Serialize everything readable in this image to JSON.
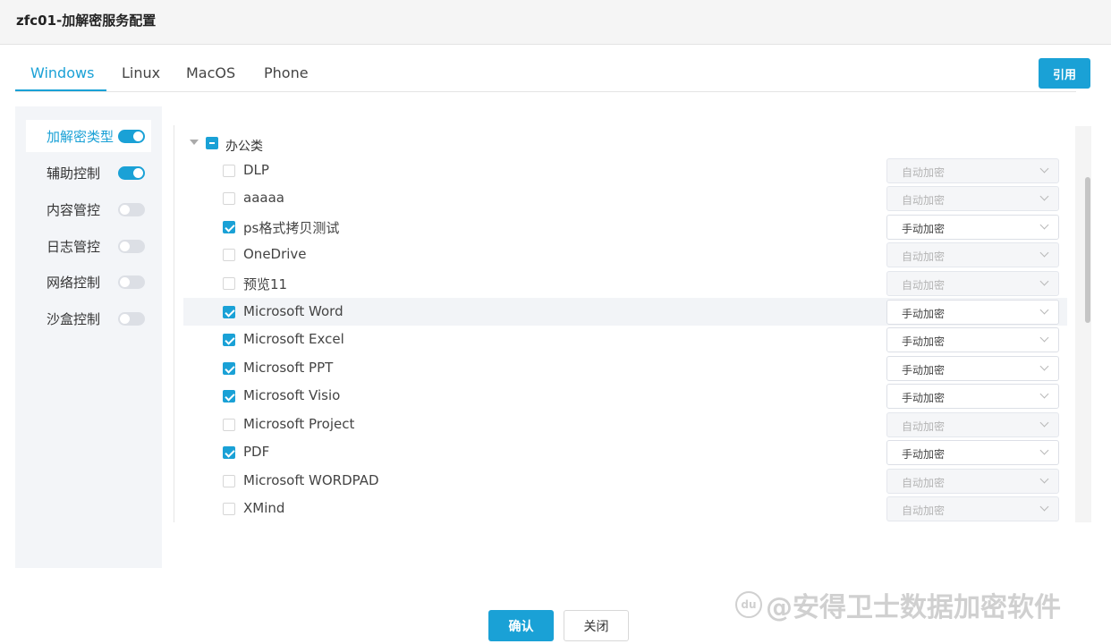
{
  "dialog": {
    "title": "zfc01-加解密服务配置"
  },
  "tabs": [
    {
      "label": "Windows",
      "active": true
    },
    {
      "label": "Linux",
      "active": false
    },
    {
      "label": "MacOS",
      "active": false
    },
    {
      "label": "Phone",
      "active": false
    }
  ],
  "cite_button": "引用",
  "sidebar": {
    "items": [
      {
        "label": "加解密类型",
        "enabled": true,
        "active": true
      },
      {
        "label": "辅助控制",
        "enabled": true,
        "active": false
      },
      {
        "label": "内容管控",
        "enabled": false,
        "active": false
      },
      {
        "label": "日志管控",
        "enabled": false,
        "active": false
      },
      {
        "label": "网络控制",
        "enabled": false,
        "active": false
      },
      {
        "label": "沙盒控制",
        "enabled": false,
        "active": false
      }
    ]
  },
  "tree": {
    "group_label": "办公类",
    "group_state": "indeterminate",
    "items": [
      {
        "label": "DLP",
        "checked": false,
        "mode": "自动加密"
      },
      {
        "label": "aaaaa",
        "checked": false,
        "mode": "自动加密"
      },
      {
        "label": "ps格式拷贝测试",
        "checked": true,
        "mode": "手动加密"
      },
      {
        "label": "OneDrive",
        "checked": false,
        "mode": "自动加密"
      },
      {
        "label": "预览11",
        "checked": false,
        "mode": "自动加密"
      },
      {
        "label": "Microsoft Word",
        "checked": true,
        "mode": "手动加密"
      },
      {
        "label": "Microsoft Excel",
        "checked": true,
        "mode": "手动加密"
      },
      {
        "label": "Microsoft PPT",
        "checked": true,
        "mode": "手动加密"
      },
      {
        "label": "Microsoft Visio",
        "checked": true,
        "mode": "手动加密"
      },
      {
        "label": "Microsoft Project",
        "checked": false,
        "mode": "自动加密"
      },
      {
        "label": "PDF",
        "checked": true,
        "mode": "手动加密"
      },
      {
        "label": "Microsoft WORDPAD",
        "checked": false,
        "mode": "自动加密"
      },
      {
        "label": "XMind",
        "checked": false,
        "mode": "自动加密"
      }
    ]
  },
  "footer": {
    "confirm": "确认",
    "close": "关闭"
  },
  "watermark": {
    "icon": "du",
    "text": "@安得卫士数据加密软件"
  },
  "colors": {
    "accent": "#1aa1d6"
  }
}
